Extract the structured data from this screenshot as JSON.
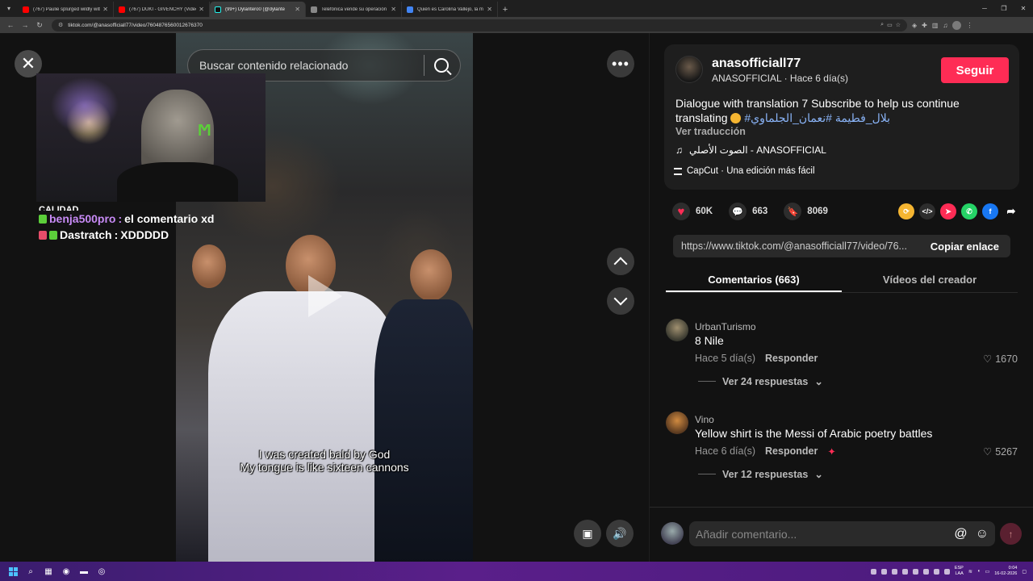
{
  "browser": {
    "tabs": [
      {
        "title": "(767) Paulie splurged wildly with",
        "color": "#ff0000",
        "active": false
      },
      {
        "title": "(767) DUKI - GIVENCHY (Video",
        "color": "#ff0000",
        "active": false
      },
      {
        "title": "(99+) Dylantero0 (@dylante",
        "color": "#25f4ee",
        "active": true
      },
      {
        "title": "Telefónica vende su operación",
        "color": "#888888",
        "active": false
      },
      {
        "title": "Quién es Carolina Vallejo, la m",
        "color": "#4285f4",
        "active": false
      }
    ],
    "url": "tiktok.com/@anasofficiall77/video/7604876560012676370"
  },
  "video": {
    "search_placeholder": "Buscar contenido relacionado",
    "caption_line1": "I was created bald by God",
    "caption_line2": "My tongue is like sixteen cannons"
  },
  "overlay": {
    "chat_partial": "CALIDAD",
    "chat": [
      {
        "user": "benja500pro",
        "message": "el comentario xd"
      },
      {
        "user": "Dastratch",
        "message": "XDDDDD"
      }
    ]
  },
  "post": {
    "username": "anasofficiall77",
    "display_name": "ANASOFFICIAL",
    "time": "Hace 6 día(s)",
    "follow_label": "Seguir",
    "description": "Dialogue with translation 7 Subscribe to help us continue translating",
    "hashtags": "#بلال_فطيمة #نعمان_الجلماوي",
    "translate_label": "Ver traducción",
    "music": "الصوت الأصلي - ANASOFFICIAL",
    "capcut": "CapCut · Una edición más fácil",
    "likes": "60K",
    "comments_count": "663",
    "saves": "8069",
    "share_url": "https://www.tiktok.com/@anasofficiall77/video/76...",
    "copy_label": "Copiar enlace"
  },
  "tabs": {
    "comments": "Comentarios (663)",
    "creator_videos": "Vídeos del creador"
  },
  "comments": [
    {
      "user": "UrbanTurismo",
      "text": "8 Nile",
      "time": "Hace 5 día(s)",
      "reply": "Responder",
      "likes": "1670",
      "more": "Ver 24 respuestas"
    },
    {
      "user": "Vino",
      "text": "Yellow shirt is the Messi of Arabic poetry battles",
      "time": "Hace 6 día(s)",
      "reply": "Responder",
      "likes": "5267",
      "more": "Ver 12 respuestas"
    }
  ],
  "comment_input": {
    "placeholder": "Añadir comentario..."
  },
  "taskbar": {
    "lang": "ESP",
    "lang2": "LAA",
    "time": "0:04",
    "date": "16-02-2026"
  },
  "colors": {
    "accent": "#fe2c55",
    "link": "#8ab4f8"
  }
}
